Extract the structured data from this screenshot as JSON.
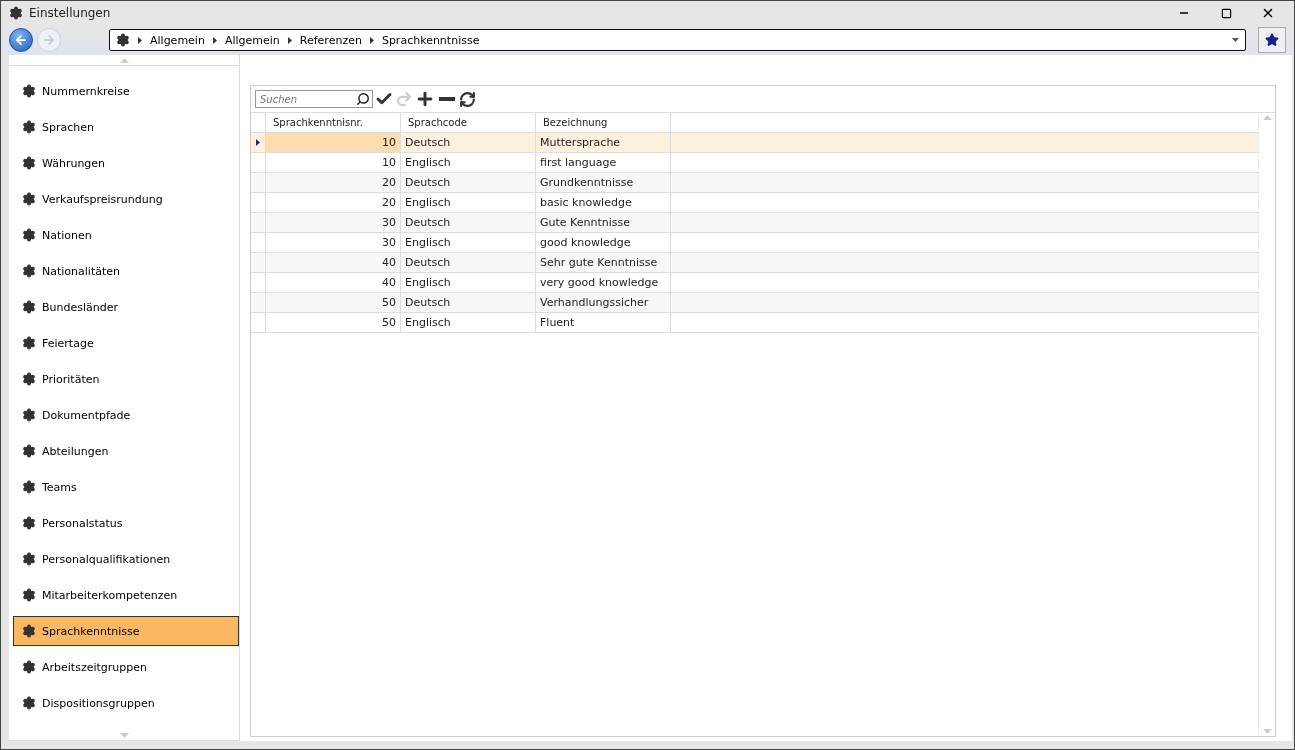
{
  "window": {
    "title": "Einstellungen"
  },
  "breadcrumb": [
    "Allgemein",
    "Allgemein",
    "Referenzen",
    "Sprachkenntnisse"
  ],
  "sidebar": {
    "items": [
      {
        "label": "Nummernkreise",
        "selected": false
      },
      {
        "label": "Sprachen",
        "selected": false
      },
      {
        "label": "Währungen",
        "selected": false
      },
      {
        "label": "Verkaufspreisrundung",
        "selected": false
      },
      {
        "label": "Nationen",
        "selected": false
      },
      {
        "label": "Nationalitäten",
        "selected": false
      },
      {
        "label": "Bundesländer",
        "selected": false
      },
      {
        "label": "Feiertage",
        "selected": false
      },
      {
        "label": "Prioritäten",
        "selected": false
      },
      {
        "label": "Dokumentpfade",
        "selected": false
      },
      {
        "label": "Abteilungen",
        "selected": false
      },
      {
        "label": "Teams",
        "selected": false
      },
      {
        "label": "Personalstatus",
        "selected": false
      },
      {
        "label": "Personalqualifikationen",
        "selected": false
      },
      {
        "label": "Mitarbeiterkompetenzen",
        "selected": false
      },
      {
        "label": "Sprachkenntnisse",
        "selected": true
      },
      {
        "label": "Arbeitszeitgruppen",
        "selected": false
      },
      {
        "label": "Dispositionsgruppen",
        "selected": false
      }
    ]
  },
  "toolbar": {
    "search": {
      "placeholder": "Suchen"
    },
    "undo_disabled": true
  },
  "table": {
    "columns": [
      "Sprachkenntnisnr.",
      "Sprachcode",
      "Bezeichnung"
    ],
    "rows": [
      {
        "cells": [
          "10",
          "Deutsch",
          "Muttersprache"
        ],
        "selected": true
      },
      {
        "cells": [
          "10",
          "Englisch",
          "first language"
        ],
        "selected": false
      },
      {
        "cells": [
          "20",
          "Deutsch",
          "Grundkenntnisse"
        ],
        "selected": false
      },
      {
        "cells": [
          "20",
          "Englisch",
          "basic knowledge"
        ],
        "selected": false
      },
      {
        "cells": [
          "30",
          "Deutsch",
          "Gute Kenntnisse"
        ],
        "selected": false
      },
      {
        "cells": [
          "30",
          "Englisch",
          "good knowledge"
        ],
        "selected": false
      },
      {
        "cells": [
          "40",
          "Deutsch",
          "Sehr gute Kenntnisse"
        ],
        "selected": false
      },
      {
        "cells": [
          "40",
          "Englisch",
          "very good knowledge"
        ],
        "selected": false
      },
      {
        "cells": [
          "50",
          "Deutsch",
          "Verhandlungssicher"
        ],
        "selected": false
      },
      {
        "cells": [
          "50",
          "Englisch",
          "Fluent"
        ],
        "selected": false
      }
    ]
  }
}
